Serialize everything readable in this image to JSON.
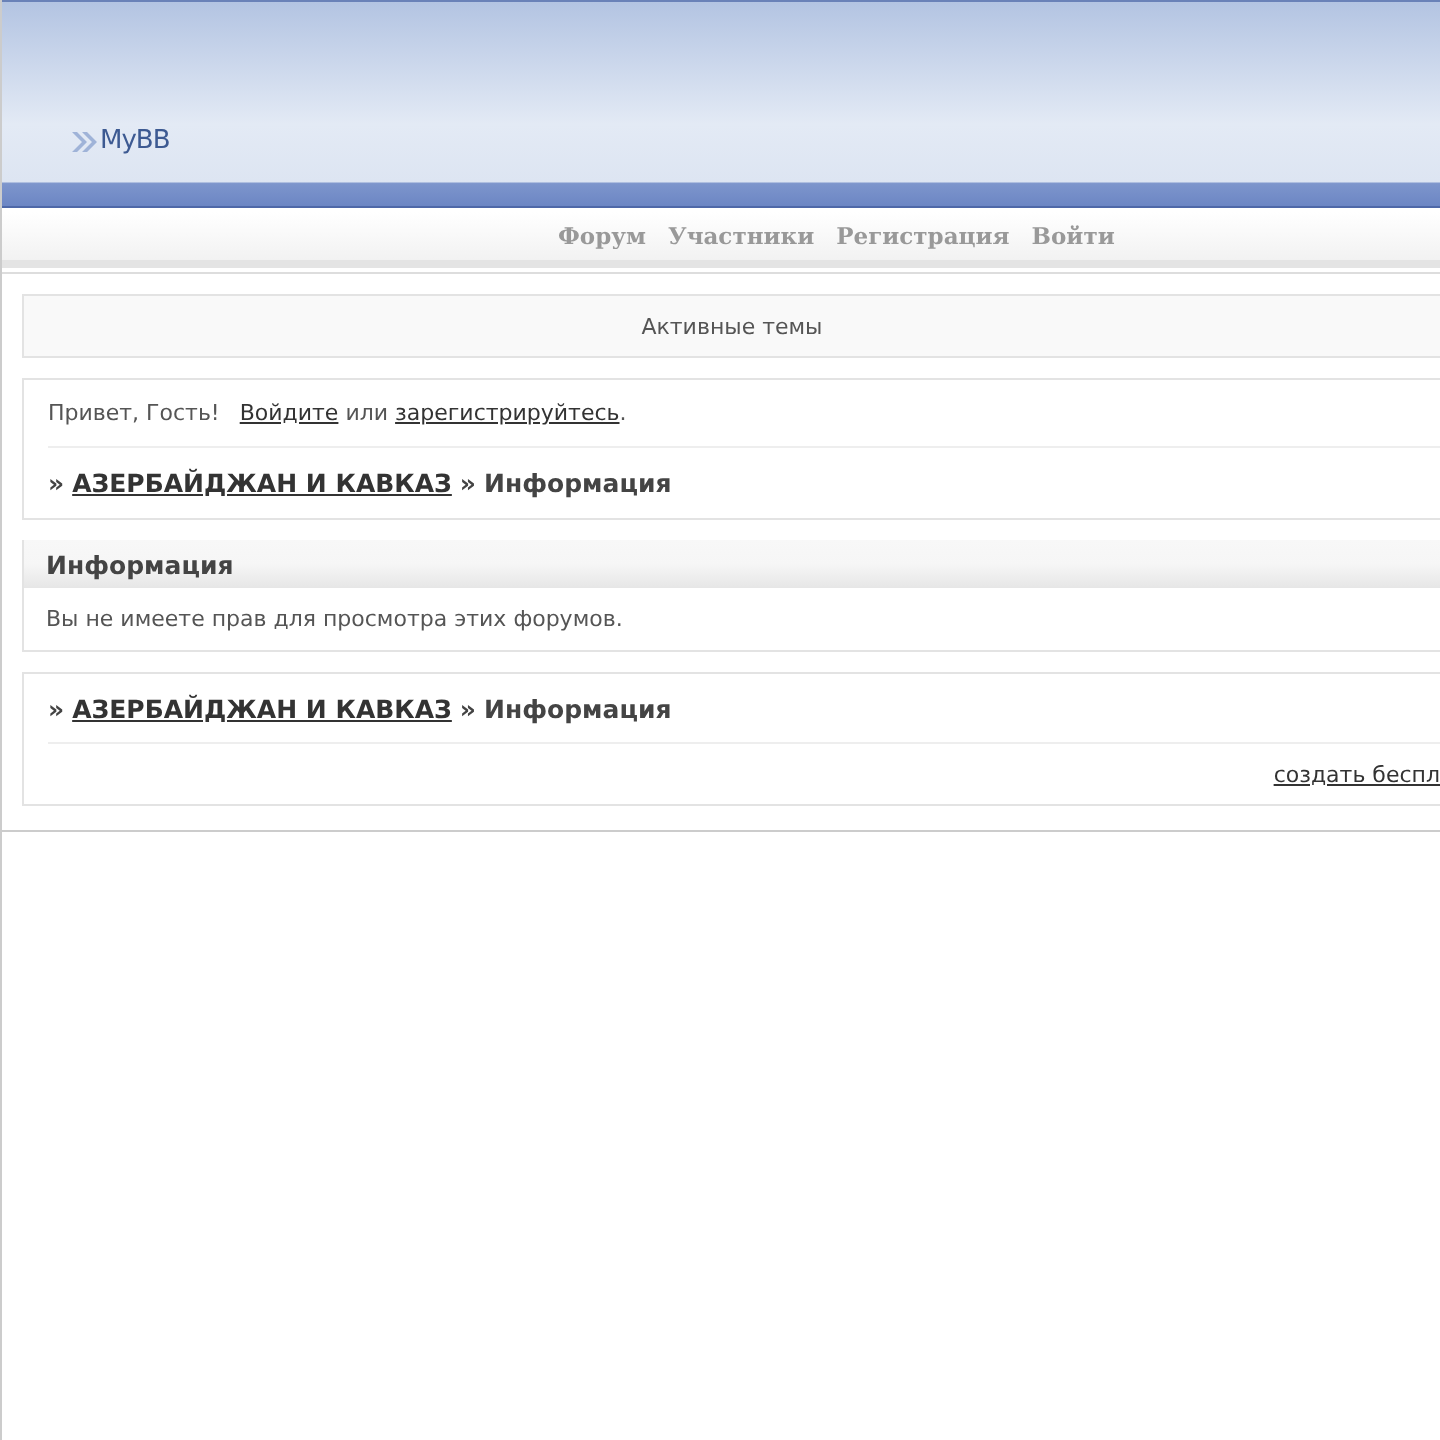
{
  "logo": {
    "text": "MyBB"
  },
  "nav": [
    {
      "label": "Форум"
    },
    {
      "label": "Участники"
    },
    {
      "label": "Регистрация"
    },
    {
      "label": "Войти"
    }
  ],
  "active_topics": {
    "label": "Активные темы"
  },
  "welcome": {
    "greeting": "Привет, Гость!",
    "login_link": "Войдите",
    "connector": "или",
    "register_link": "зарегистрируйтесь",
    "end": "."
  },
  "breadcrumb_top": [
    {
      "separator": "»",
      "label": "АЗЕРБАЙДЖАН И КАВКАЗ",
      "link": true
    },
    {
      "separator": "»",
      "label": "Информация",
      "link": false
    }
  ],
  "info_panel": {
    "title": "Информация",
    "message": "Вы не имеете прав для просмотра этих форумов."
  },
  "breadcrumb_bottom": [
    {
      "separator": "»",
      "label": "АЗЕРБАЙДЖАН И КАВКАЗ",
      "link": true
    },
    {
      "separator": "»",
      "label": "Информация",
      "link": false
    }
  ],
  "footer_link": "создать беспл"
}
